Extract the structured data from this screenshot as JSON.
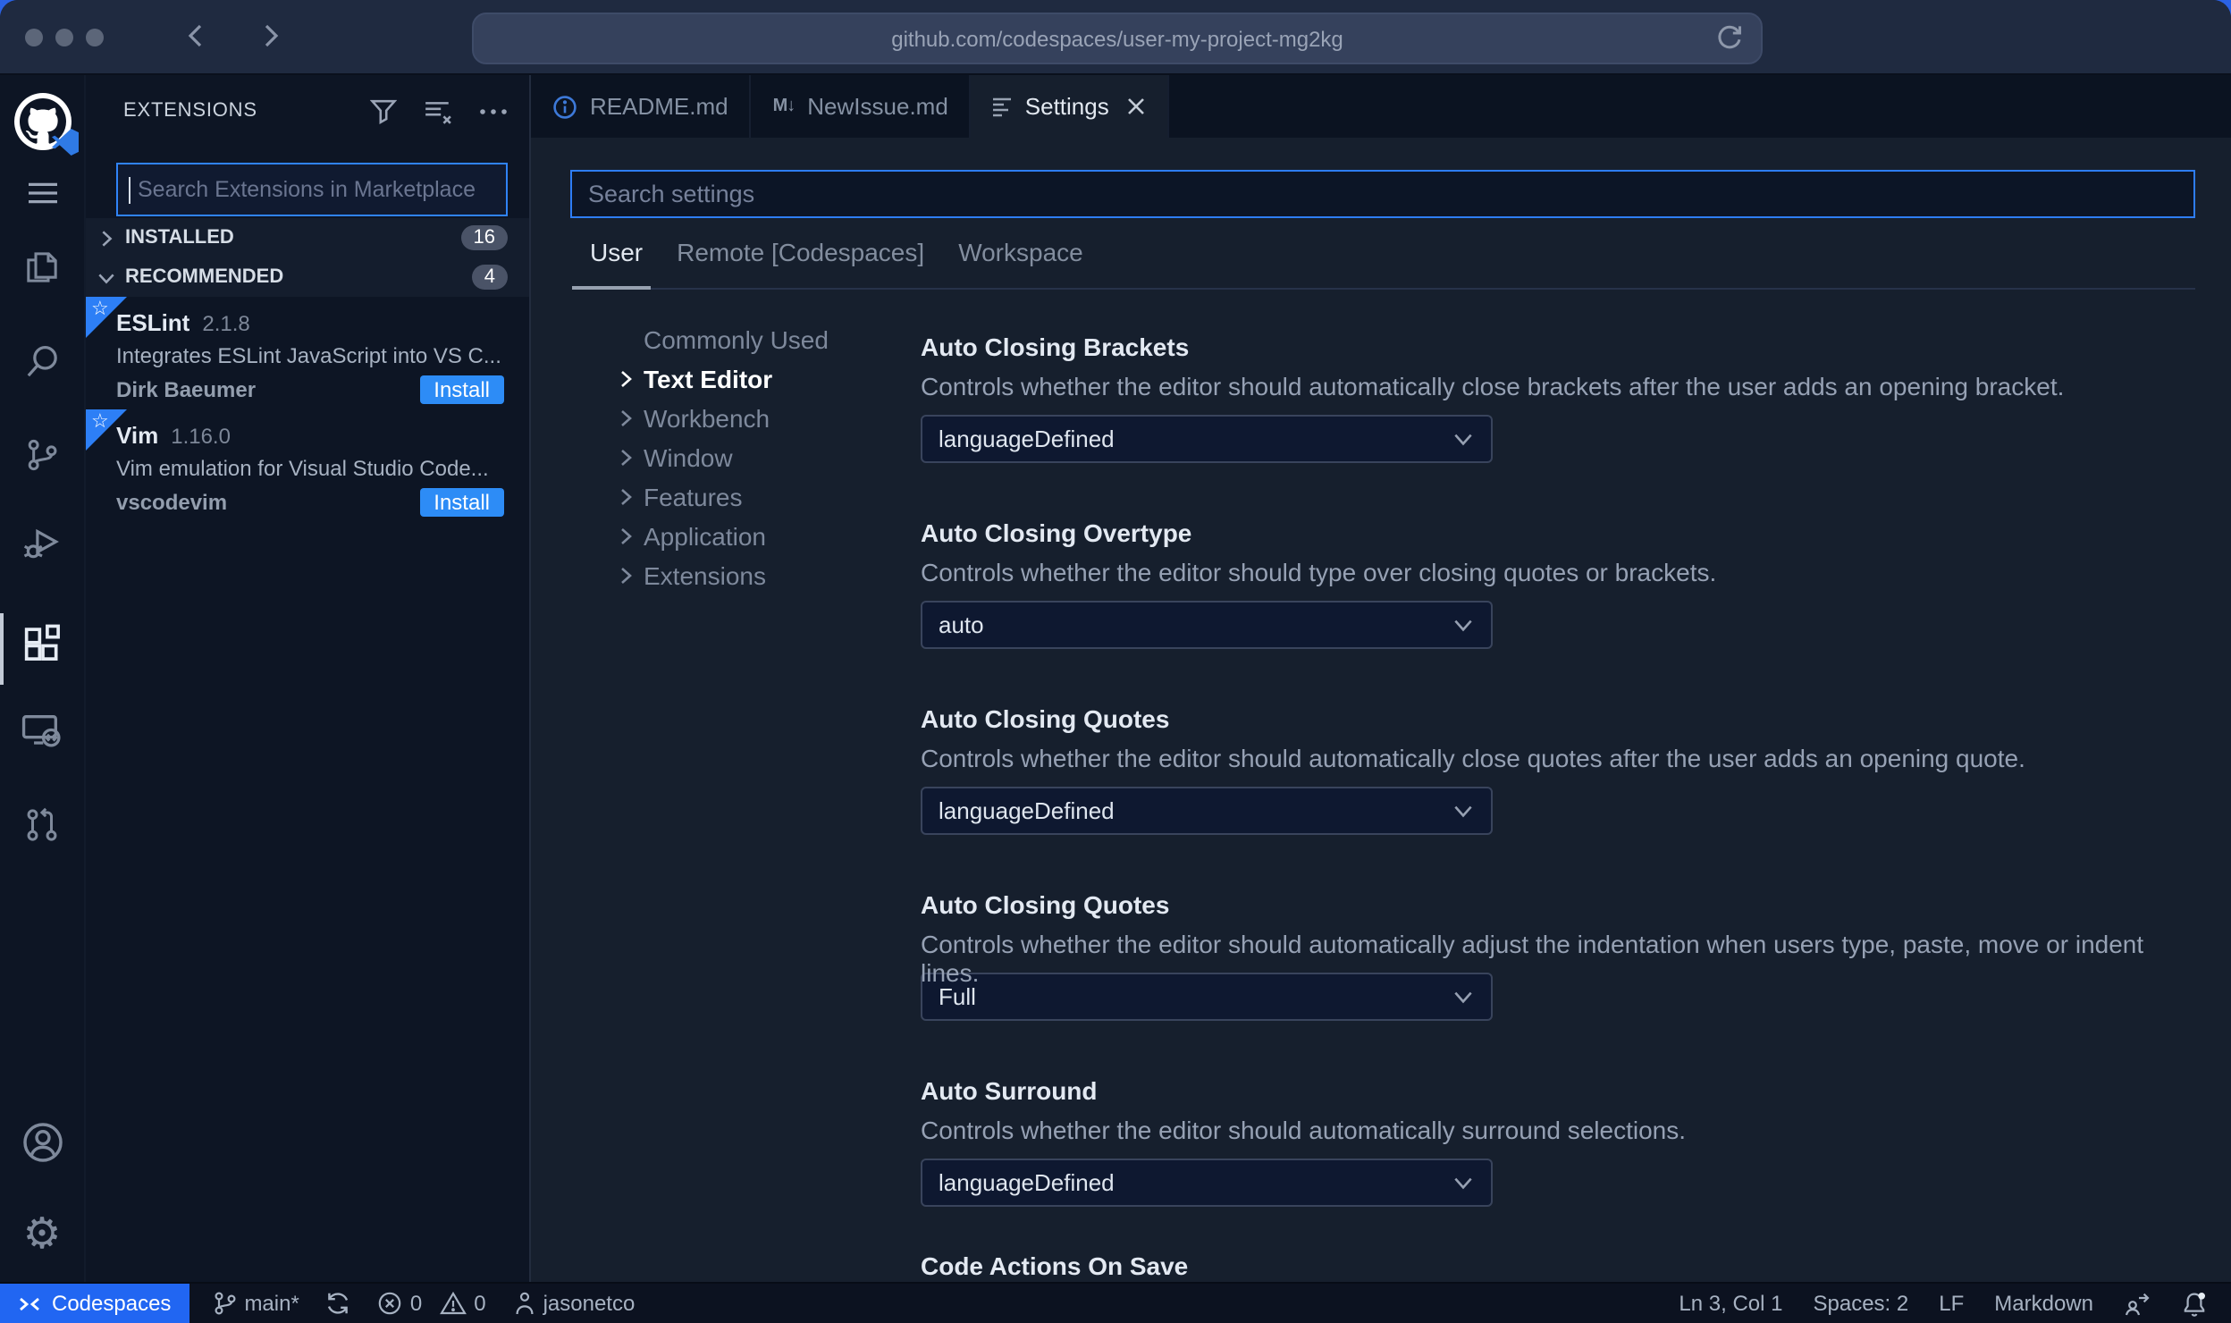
{
  "browser": {
    "url": "github.com/codespaces/user-my-project-mg2kg"
  },
  "activity_bar": {
    "icons": [
      "github-logo",
      "menu",
      "explorer",
      "search",
      "source-control",
      "run-debug",
      "extensions",
      "remote-explorer",
      "pull-requests",
      "account",
      "settings-gear"
    ],
    "active": "extensions"
  },
  "sidebar": {
    "title": "EXTENSIONS",
    "search_placeholder": "Search Extensions in Marketplace",
    "sections": {
      "installed": {
        "label": "INSTALLED",
        "count": "16"
      },
      "recommended": {
        "label": "RECOMMENDED",
        "count": "4"
      }
    },
    "extensions": [
      {
        "name": "ESLint",
        "version": "2.1.8",
        "description": "Integrates ESLint JavaScript into VS C...",
        "publisher": "Dirk Baeumer",
        "action": "Install"
      },
      {
        "name": "Vim",
        "version": "1.16.0",
        "description": "Vim emulation for Visual Studio Code...",
        "publisher": "vscodevim",
        "action": "Install"
      }
    ]
  },
  "tabs": [
    {
      "label": "README.md"
    },
    {
      "label": "NewIssue.md",
      "icon_text": "M↓"
    },
    {
      "label": "Settings"
    }
  ],
  "settings": {
    "search_placeholder": "Search settings",
    "scopes": [
      "User",
      "Remote [Codespaces]",
      "Workspace"
    ],
    "active_scope": "User",
    "toc": [
      "Commonly Used",
      "Text Editor",
      "Workbench",
      "Window",
      "Features",
      "Application",
      "Extensions"
    ],
    "active_toc": "Text Editor",
    "rows": [
      {
        "title": "Auto Closing Brackets",
        "description": "Controls whether the editor should automatically close brackets after the user adds an opening bracket.",
        "value": "languageDefined"
      },
      {
        "title": "Auto Closing Overtype",
        "description": "Controls whether the editor should type over closing quotes or brackets.",
        "value": "auto"
      },
      {
        "title": "Auto Closing Quotes",
        "description": "Controls whether the editor should automatically close quotes after the user adds an opening quote.",
        "value": "languageDefined"
      },
      {
        "title": "Auto Closing Quotes",
        "description": "Controls whether the editor should automatically adjust the indentation when users type, paste, move or indent lines.",
        "value": "Full"
      },
      {
        "title": "Auto Surround",
        "description": "Controls whether the editor should automatically surround selections.",
        "value": "languageDefined"
      },
      {
        "title": "Code Actions On Save"
      }
    ]
  },
  "status_bar": {
    "left": {
      "codespaces": "Codespaces",
      "branch": "main*",
      "errors": "0",
      "warnings": "0",
      "user": "jasonetco"
    },
    "right": {
      "cursor": "Ln 3, Col 1",
      "indent": "Spaces: 2",
      "eol": "LF",
      "language": "Markdown"
    }
  },
  "colors": {
    "accent": "#2E7DF6",
    "install_button": "#2D8CF6",
    "codespaces_chip": "#2166F2",
    "desktop": "#2B62E4",
    "ribbon": "#2D7FF6"
  }
}
